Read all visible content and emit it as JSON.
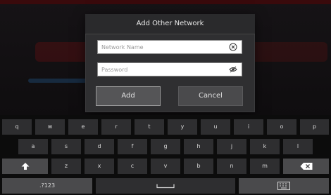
{
  "dialog": {
    "title": "Add Other Network",
    "network_name_placeholder": "Network Name",
    "password_placeholder": "Password",
    "add_label": "Add",
    "cancel_label": "Cancel"
  },
  "keyboard": {
    "row1": [
      "q",
      "w",
      "e",
      "r",
      "t",
      "y",
      "u",
      "i",
      "o",
      "p"
    ],
    "row2": [
      "a",
      "s",
      "d",
      "f",
      "g",
      "h",
      "j",
      "k",
      "l"
    ],
    "row3": [
      "z",
      "x",
      "c",
      "v",
      "b",
      "n",
      "m"
    ],
    "symbols_label": ".?123"
  },
  "colors": {
    "dialog_bg": "#2f2f31",
    "key_bg": "#2e2e30",
    "special_key_bg": "#4a4a4c",
    "background_accent": "#3a0a0c"
  },
  "icons": {
    "clear": "close-circle-icon",
    "password_visibility": "eye-icon",
    "shift": "shift-arrow-icon",
    "backspace": "backspace-icon",
    "space": "space-bar-icon",
    "hide_keyboard": "keyboard-icon"
  }
}
